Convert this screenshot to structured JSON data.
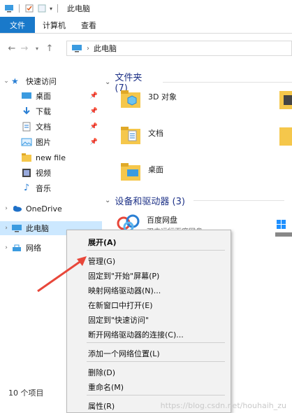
{
  "window": {
    "title": "此电脑"
  },
  "ribbon": {
    "tabs": [
      "文件",
      "计算机",
      "查看"
    ]
  },
  "address": {
    "path": "此电脑"
  },
  "sidebar": {
    "items": [
      {
        "label": "快速访问"
      },
      {
        "label": "桌面"
      },
      {
        "label": "下载"
      },
      {
        "label": "文档"
      },
      {
        "label": "图片"
      },
      {
        "label": "new file"
      },
      {
        "label": "视频"
      },
      {
        "label": "音乐"
      },
      {
        "label": "OneDrive"
      },
      {
        "label": "此电脑"
      },
      {
        "label": "网络"
      }
    ]
  },
  "main": {
    "folders_section": "文件夹 (7)",
    "folders": [
      "3D 对象",
      "文档",
      "桌面"
    ],
    "devices_section": "设备和驱动器 (3)",
    "devices": [
      {
        "name": "百度网盘",
        "sub": "双击运行百度网盘"
      }
    ]
  },
  "status": {
    "count": "10 个项目"
  },
  "context_menu": {
    "items": [
      "展开(A)",
      "管理(G)",
      "固定到\"开始\"屏幕(P)",
      "映射网络驱动器(N)...",
      "在新窗口中打开(E)",
      "固定到\"快速访问\"",
      "断开网络驱动器的连接(C)...",
      "添加一个网络位置(L)",
      "删除(D)",
      "重命名(M)",
      "属性(R)"
    ]
  },
  "watermark": "https://blog.csdn.net/houhaih_zu",
  "colors": {
    "accent": "#1979ca",
    "selection": "#cce8ff",
    "arrow": "#e8473a"
  }
}
